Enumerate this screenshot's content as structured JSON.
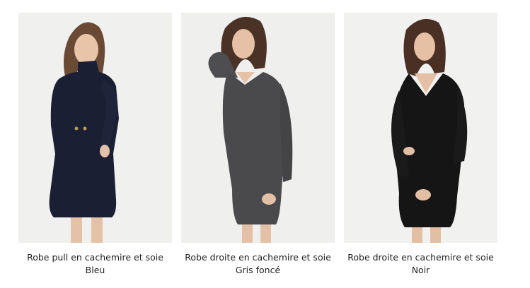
{
  "products": [
    {
      "name": "Robe pull en cachemire et soie",
      "color": "Bleu",
      "dress_hex": "#1b1f33",
      "photo_bg": "#f0f0ef",
      "image_icon": "dress-photo-icon"
    },
    {
      "name": "Robe droite en cachemire et soie",
      "color": "Gris foncé",
      "dress_hex": "#4a4a4c",
      "photo_bg": "#efefee",
      "image_icon": "dress-photo-icon"
    },
    {
      "name": "Robe droite en cachemire et soie",
      "color": "Noir",
      "dress_hex": "#151515",
      "photo_bg": "#f1f1f0",
      "image_icon": "dress-photo-icon"
    }
  ]
}
